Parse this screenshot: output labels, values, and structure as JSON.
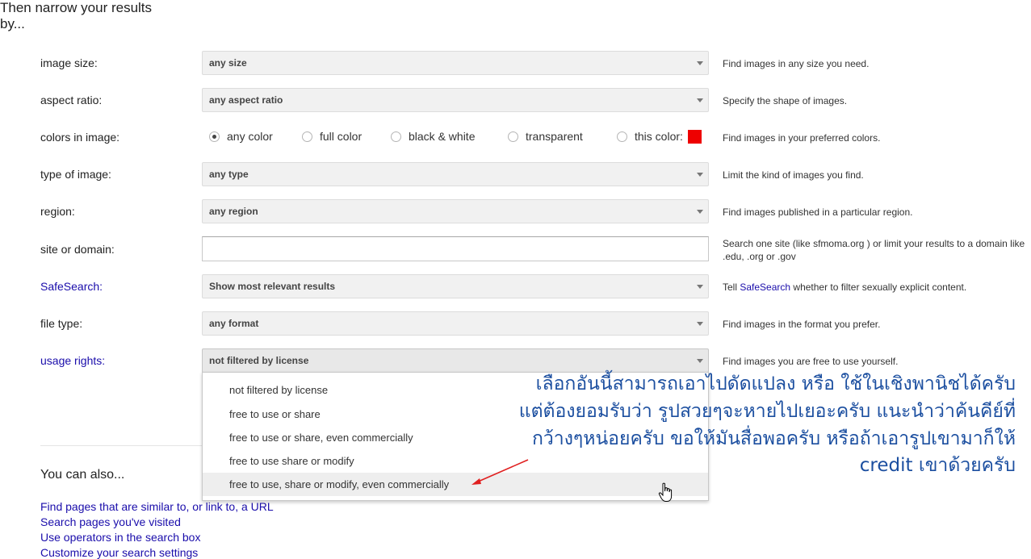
{
  "heading": "Then narrow your results by...",
  "rows": {
    "image_size": {
      "label": "image size:",
      "value": "any size",
      "help": "Find images in any size you need."
    },
    "aspect_ratio": {
      "label": "aspect ratio:",
      "value": "any aspect ratio",
      "help": "Specify the shape of images."
    },
    "colors": {
      "label": "colors in image:",
      "options": [
        "any color",
        "full color",
        "black & white",
        "transparent",
        "this color:"
      ],
      "selected": "any color",
      "swatch_color": "#ee0000",
      "help": "Find images in your preferred colors."
    },
    "type": {
      "label": "type of image:",
      "value": "any type",
      "help": "Limit the kind of images you find."
    },
    "region": {
      "label": "region:",
      "value": "any region",
      "help": "Find images published in a particular region."
    },
    "site": {
      "label": "site or domain:",
      "value": "",
      "help_line1_a": "Search one site (like ",
      "help_line1_b": "sfmoma.org",
      "help_line1_c": " ) or limit your results to a domain like",
      "help_line2": ".edu, .org or .gov"
    },
    "safesearch": {
      "label": "SafeSearch:",
      "value": "Show most relevant results",
      "help_a": "Tell ",
      "help_link": "SafeSearch",
      "help_b": " whether to filter sexually explicit content."
    },
    "file_type": {
      "label": "file type:",
      "value": "any format",
      "help": "Find images in the format you prefer."
    },
    "usage_rights": {
      "label": "usage rights:",
      "value": "not filtered by license",
      "help": "Find images you are free to use yourself.",
      "options": [
        "not filtered by license",
        "free to use or share",
        "free to use or share, even commercially",
        "free to use share or modify",
        "free to use, share or modify, even commercially"
      ],
      "hovered": "free to use, share or modify, even commercially"
    }
  },
  "also": {
    "heading": "You can also...",
    "links": [
      "Find pages that are similar to, or link to, a URL",
      "Search pages you've visited",
      "Use operators in the search box",
      "Customize your search settings"
    ]
  },
  "annotation": {
    "lines": [
      "เลือกอันนี้สามารถเอาไปดัดแปลง หรือ ใช้ในเชิงพานิชได้ครับ",
      "แต่ต้องยอมรับว่า รูปสวยๆจะหายไปเยอะครับ แนะนำว่าค้นคีย์ที่",
      "กว้างๆหน่อยครับ ขอให้มันสื่อพอครับ    หรือถ้าเอารูปเขามาก็ให้",
      "credit เขาด้วยครับ"
    ],
    "color": "#1c4fa0",
    "arrow_color": "#e02020"
  }
}
